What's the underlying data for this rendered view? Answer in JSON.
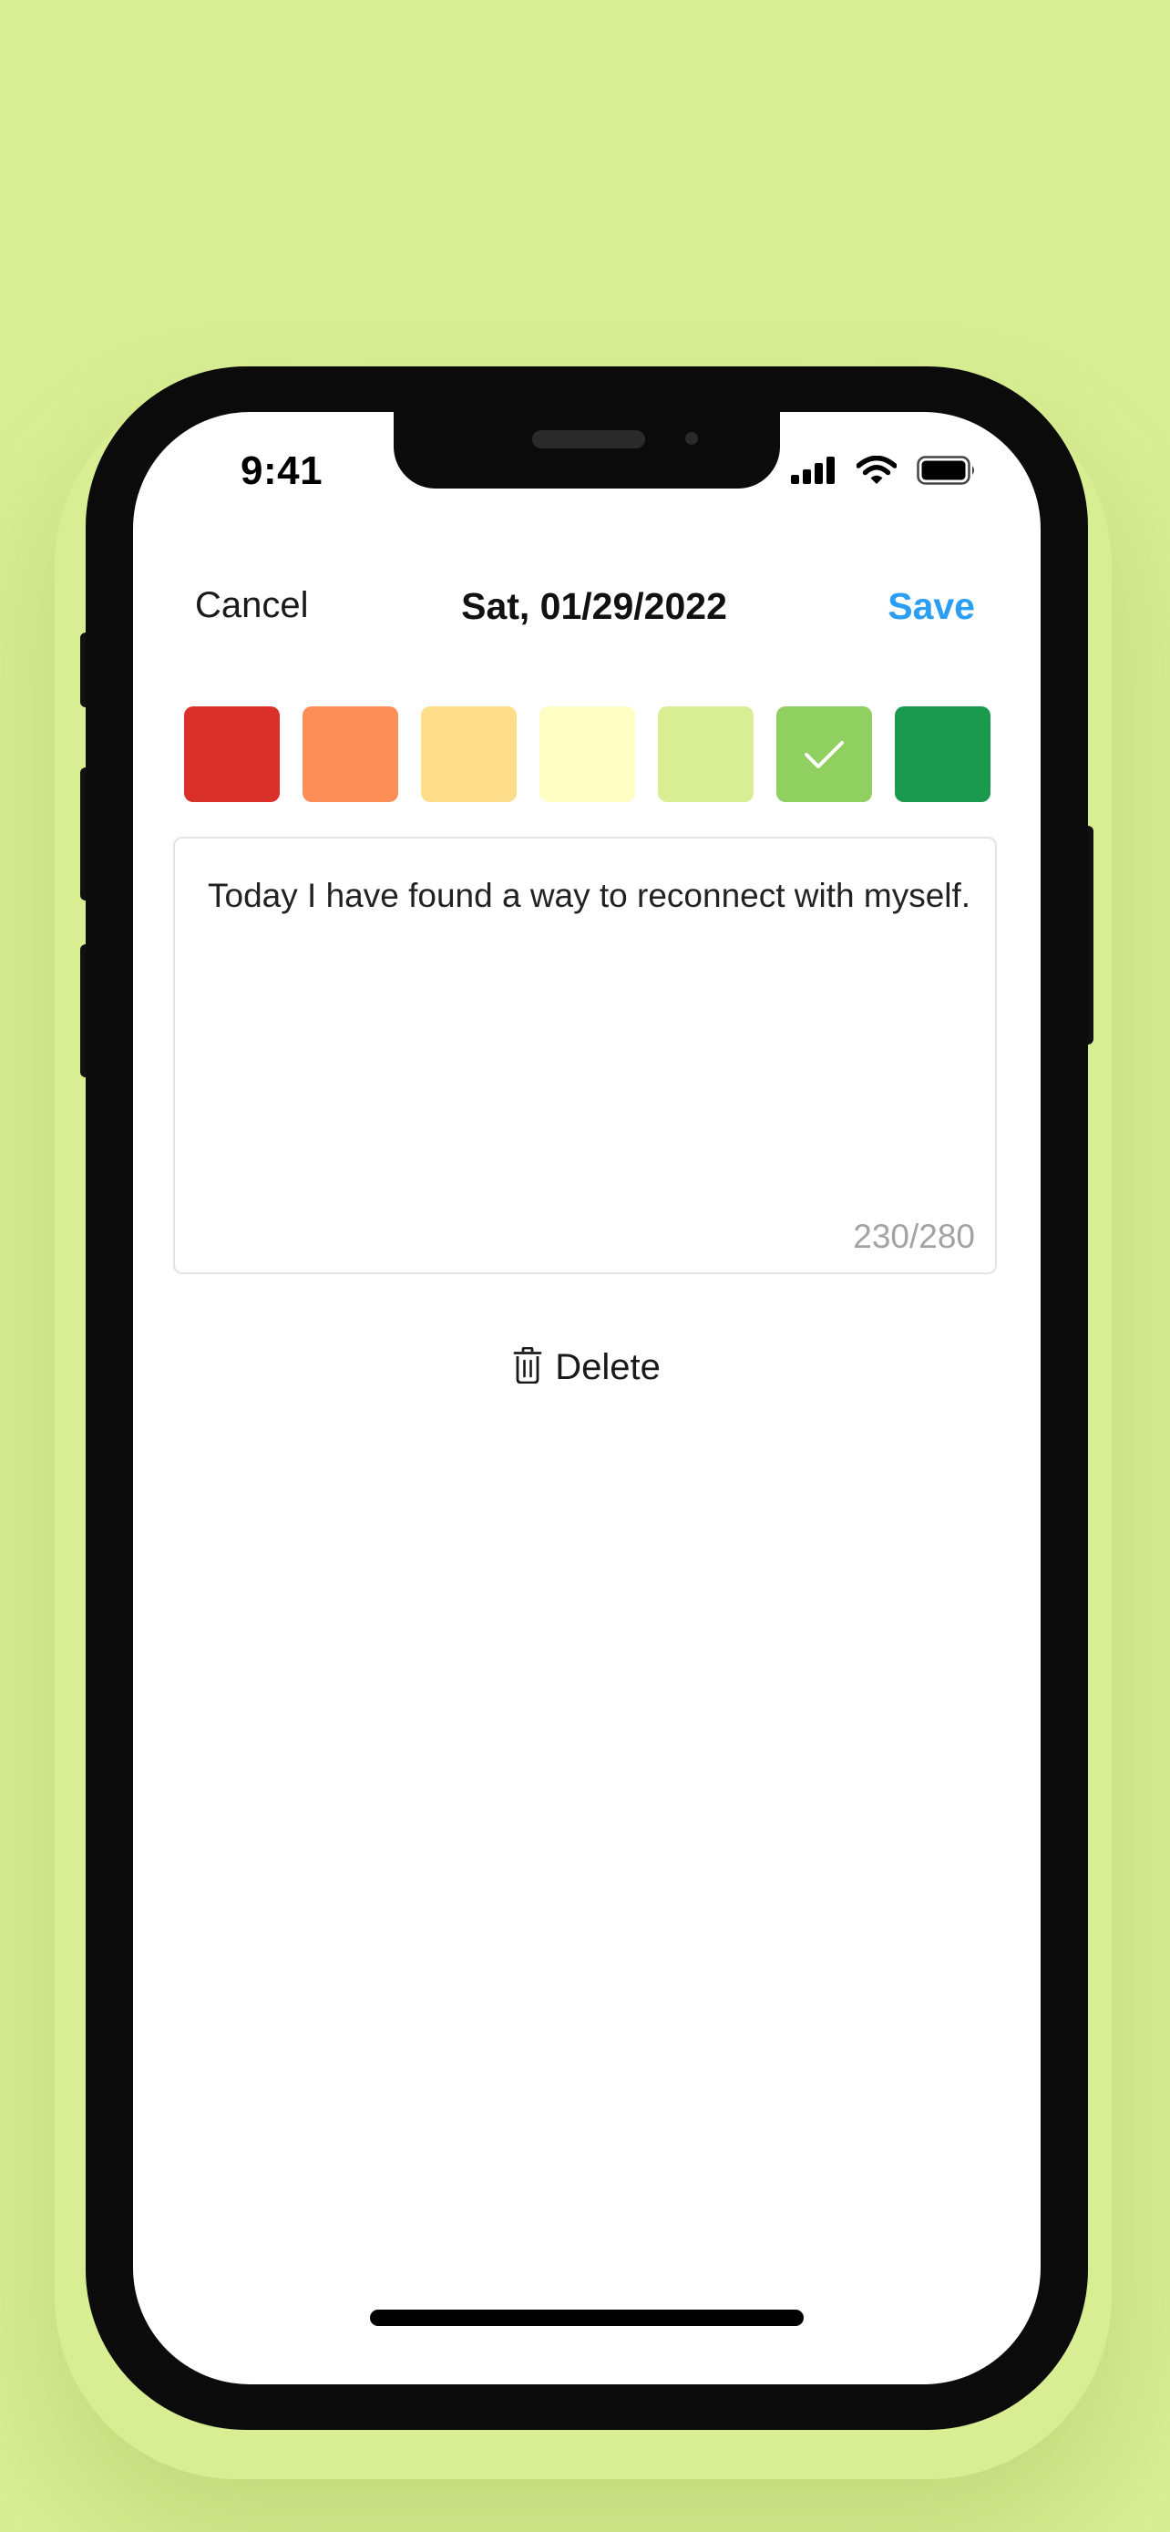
{
  "status_bar": {
    "time": "9:41",
    "icons": [
      "signal-icon",
      "wifi-icon",
      "battery-icon"
    ]
  },
  "nav": {
    "cancel_label": "Cancel",
    "title": "Sat, 01/29/2022",
    "save_label": "Save"
  },
  "mood_swatches": {
    "colors": [
      "#d9302a",
      "#fd8e58",
      "#fede8a",
      "#fffec4",
      "#d9ee93",
      "#8fd060",
      "#1a9a4e"
    ],
    "selected_index": 5,
    "selected_icon": "checkmark-icon"
  },
  "note": {
    "text": "Today I have found a way to reconnect with myself.",
    "counter": "230/280"
  },
  "delete": {
    "label": "Delete",
    "icon": "trash-icon"
  },
  "colors": {
    "background": "#d9ee93",
    "accent": "#2a9df4"
  }
}
